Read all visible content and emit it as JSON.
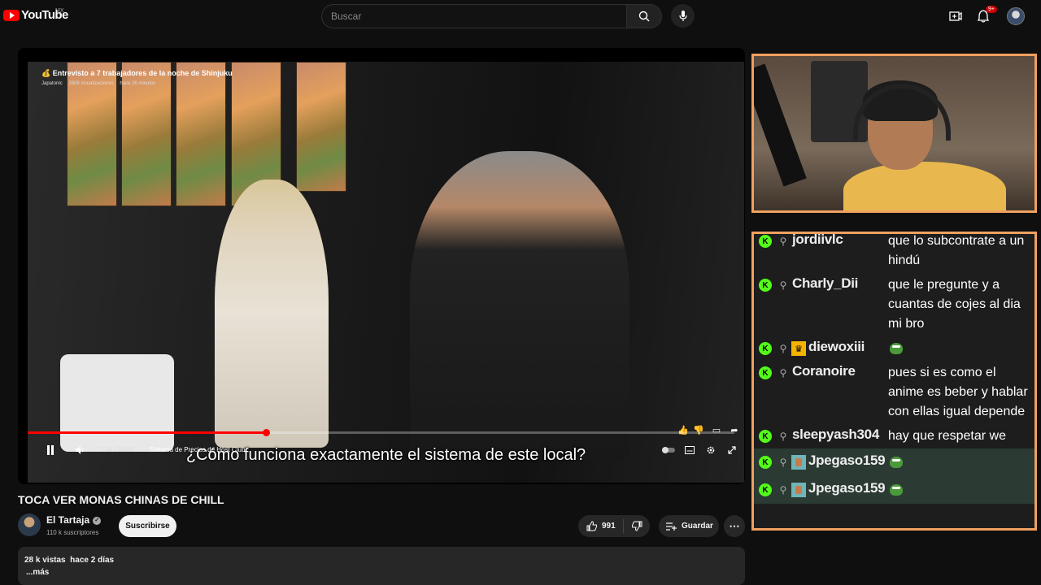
{
  "brand": {
    "logo_text": "YouTube",
    "region": "MX",
    "accent": "#ff0000"
  },
  "search": {
    "placeholder": "Buscar"
  },
  "header": {
    "notifications_count": "9+"
  },
  "player": {
    "overlay_title": "Entrevisto a 7 trabajadores de la noche de Shinjuku",
    "overlay_channel": "Japatonic",
    "overlay_views": "2608 visualizaciones",
    "overlay_time": "hace 26 minutos",
    "caption": "¿Cómo funciona exactamente el sistema de este local?",
    "time": "7:34 / 22:49",
    "chapter": "Sistema de Precios de Host Club",
    "progress": 0.337
  },
  "video": {
    "title": "TOCA VER MONAS CHINAS DE CHILL",
    "channel": "El Tartaja",
    "subscribers": "110 k suscriptores",
    "subscribe_label": "Suscribirse",
    "likes": "991",
    "save_label": "Guardar",
    "views": "28 k vistas",
    "date": "hace 2 días",
    "more_label": "...más"
  },
  "chat": {
    "accent": "#f0a060",
    "messages": [
      {
        "user": "jordiivlc",
        "text": "que lo subcontrate a un hindú",
        "badge": "user"
      },
      {
        "user": "Charly_Dii",
        "text": "que le pregunte y a cuantas de cojes al dia mi bro",
        "badge": "user"
      },
      {
        "user": "diewoxiii",
        "text": "",
        "badge": "crown",
        "emote": true
      },
      {
        "user": "Coranoire",
        "text": "pues si es como el anime es beber y hablar con ellas igual depende",
        "badge": "user"
      },
      {
        "user": "sleepyash304",
        "text": "hay que respetar we",
        "badge": "user"
      },
      {
        "user": "Jpegaso159",
        "text": "",
        "badge": "avatar",
        "emote": true,
        "highlight": true
      },
      {
        "user": "Jpegaso159",
        "text": "",
        "badge": "avatar",
        "emote": true,
        "highlight": true
      }
    ]
  }
}
